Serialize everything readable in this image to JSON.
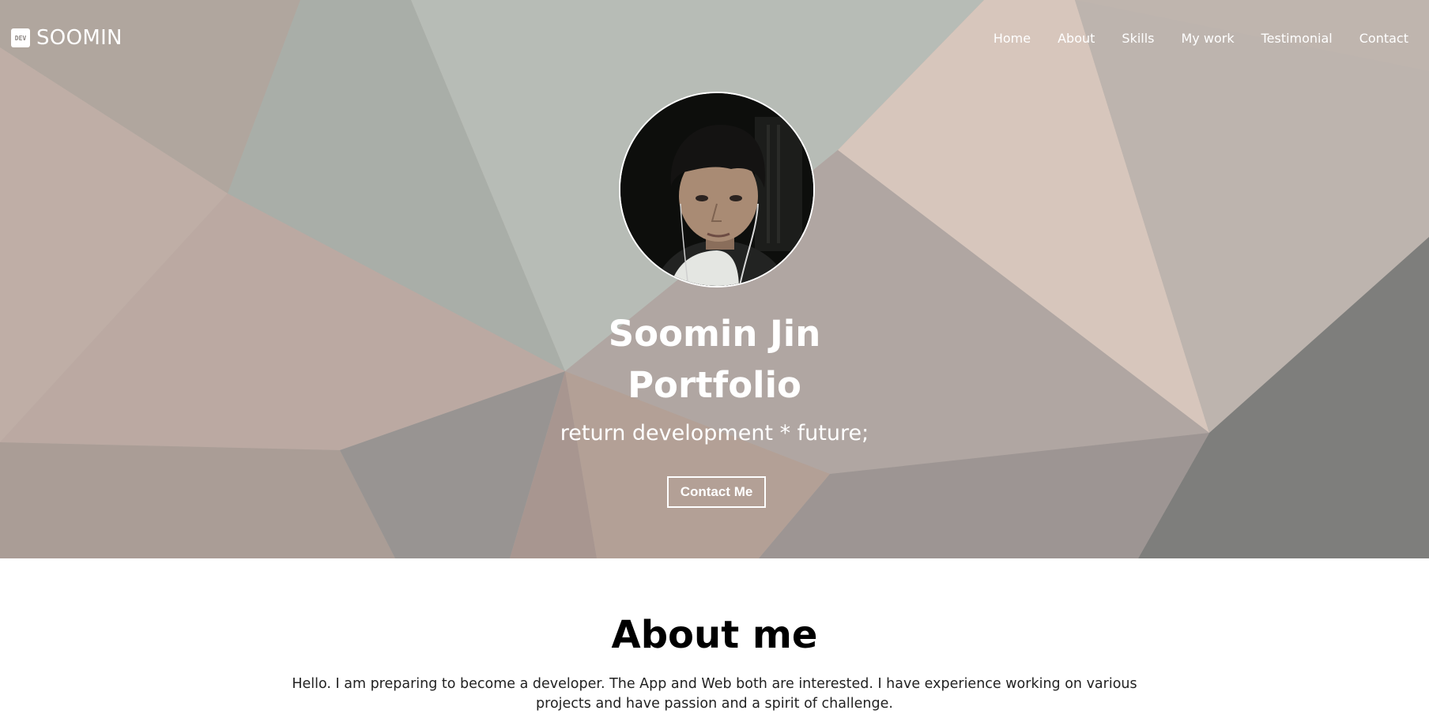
{
  "brand": {
    "icon_text": "DEV",
    "name": "SOOMIN",
    "icon": "dev-logo-icon"
  },
  "nav": {
    "items": [
      "Home",
      "About",
      "Skills",
      "My work",
      "Testimonial",
      "Contact"
    ]
  },
  "hero": {
    "title_line1": "Soomin Jin",
    "title_line2": "Portfolio",
    "subtitle": "return development * future;",
    "button_label": "Contact Me",
    "avatar": "profile-photo"
  },
  "about": {
    "title": "About me",
    "text": "Hello. I am preparing to become a developer. The App and Web both are interested. I have experience working on various projects and have passion and a spirit of challenge."
  },
  "colors": {
    "text_on_hero": "#ffffff",
    "page_background": "#ffffff",
    "heading": "#000000"
  }
}
